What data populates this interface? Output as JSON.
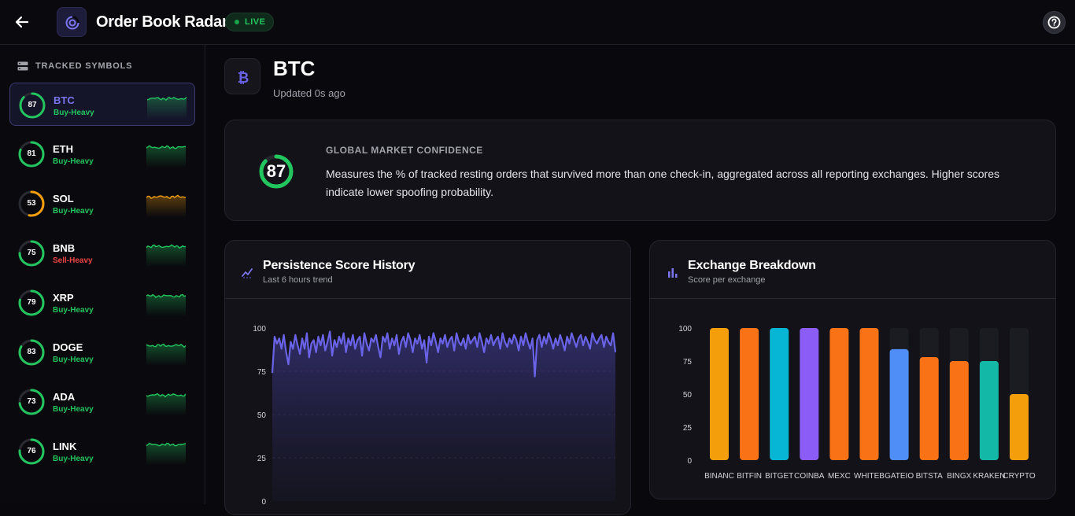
{
  "header": {
    "title": "Order Book Radar",
    "live_label": "LIVE"
  },
  "sidebar": {
    "heading": "TRACKED SYMBOLS",
    "items": [
      {
        "symbol": "BTC",
        "score": "87",
        "tag": "Buy-Heavy",
        "color": "#22c55e",
        "tag_color": "#22c55e",
        "active": true
      },
      {
        "symbol": "ETH",
        "score": "81",
        "tag": "Buy-Heavy",
        "color": "#22c55e",
        "tag_color": "#22c55e",
        "active": false
      },
      {
        "symbol": "SOL",
        "score": "53",
        "tag": "Buy-Heavy",
        "color": "#f59e0b",
        "tag_color": "#22c55e",
        "active": false
      },
      {
        "symbol": "BNB",
        "score": "75",
        "tag": "Sell-Heavy",
        "color": "#22c55e",
        "tag_color": "#ef4444",
        "active": false
      },
      {
        "symbol": "XRP",
        "score": "79",
        "tag": "Buy-Heavy",
        "color": "#22c55e",
        "tag_color": "#22c55e",
        "active": false
      },
      {
        "symbol": "DOGE",
        "score": "83",
        "tag": "Buy-Heavy",
        "color": "#22c55e",
        "tag_color": "#22c55e",
        "active": false
      },
      {
        "symbol": "ADA",
        "score": "73",
        "tag": "Buy-Heavy",
        "color": "#22c55e",
        "tag_color": "#22c55e",
        "active": false
      },
      {
        "symbol": "LINK",
        "score": "76",
        "tag": "Buy-Heavy",
        "color": "#22c55e",
        "tag_color": "#22c55e",
        "active": false
      }
    ]
  },
  "main": {
    "coin": "BTC",
    "updated": "Updated 0s ago"
  },
  "confidence": {
    "label": "GLOBAL MARKET CONFIDENCE",
    "score": "87",
    "description": "Measures the % of tracked resting orders that survived more than one check-in, aggregated across all reporting exchanges. Higher scores indicate lower spoofing probability."
  },
  "history_card": {
    "title": "Persistence Score History",
    "subtitle": "Last 6 hours trend"
  },
  "exchange_card": {
    "title": "Exchange Breakdown",
    "subtitle": "Score per exchange"
  },
  "colors": {
    "accent": "#6a63e8",
    "green": "#22c55e",
    "orange": "#f97316"
  },
  "chart_data": [
    {
      "type": "area",
      "ylim": [
        0,
        100
      ],
      "yticks": [
        0,
        25,
        50,
        75,
        100
      ],
      "series": [
        {
          "values": [
            74,
            95,
            91,
            94,
            88,
            96,
            86,
            79,
            92,
            88,
            96,
            90,
            85,
            94,
            88,
            97,
            83,
            91,
            93,
            86,
            95,
            90,
            96,
            87,
            92,
            98,
            84,
            93,
            89,
            95,
            91,
            97,
            86,
            94,
            90,
            96,
            88,
            93,
            95,
            84,
            97,
            91,
            87,
            94,
            92,
            96,
            89,
            83,
            95,
            92,
            97,
            88,
            94,
            90,
            96,
            85,
            92,
            95,
            89,
            97,
            93,
            86,
            94,
            91,
            96,
            88,
            93,
            80,
            95,
            90,
            97,
            92,
            86,
            94,
            91,
            96,
            89,
            93,
            95,
            87,
            97,
            92,
            90,
            94,
            88,
            96,
            91,
            93,
            95,
            89,
            97,
            92,
            86,
            94,
            91,
            96,
            90,
            93,
            95,
            88,
            97,
            92,
            89,
            94,
            91,
            96,
            93,
            87,
            95,
            90,
            97,
            92,
            88,
            94,
            72,
            93,
            96,
            89,
            95,
            91,
            97,
            93,
            88,
            94,
            90,
            96,
            92,
            87,
            95,
            91,
            97,
            93,
            89,
            94,
            96,
            90,
            95,
            92,
            88,
            97,
            93,
            91,
            94,
            96,
            89,
            95,
            92,
            90,
            97,
            86
          ]
        }
      ]
    },
    {
      "type": "bar",
      "ylim": [
        0,
        100
      ],
      "yticks": [
        0,
        25,
        50,
        75,
        100
      ],
      "categories": [
        "BINANC",
        "BITFIN",
        "BITGET",
        "COINBA",
        "MEXC",
        "WHITEB",
        "GATEIO",
        "BITSTA",
        "BINGX",
        "KRAKEN",
        "CRYPTO"
      ],
      "values": [
        100,
        100,
        100,
        100,
        100,
        100,
        84,
        78,
        75,
        75,
        50
      ],
      "bar_colors": [
        "#f59e0b",
        "#f97316",
        "#06b6d4",
        "#8b5cf6",
        "#f97316",
        "#f97316",
        "#4f8ef7",
        "#f97316",
        "#f97316",
        "#14b8a6",
        "#f59e0b"
      ]
    }
  ]
}
